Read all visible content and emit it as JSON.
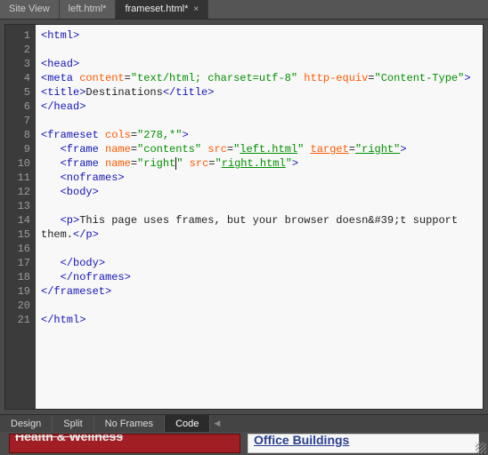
{
  "tabs": [
    {
      "label": "Site View",
      "active": false,
      "closable": false
    },
    {
      "label": "left.html*",
      "active": false,
      "closable": true
    },
    {
      "label": "frameset.html*",
      "active": true,
      "closable": true
    }
  ],
  "lines": [
    "1",
    "2",
    "3",
    "4",
    "5",
    "6",
    "7",
    "8",
    "9",
    "10",
    "11",
    "12",
    "13",
    "14",
    "",
    "15",
    "16",
    "17",
    "18",
    "19",
    "20",
    "21"
  ],
  "code": {
    "l1": {
      "open": "<html>"
    },
    "l3": {
      "open": "<head>"
    },
    "l4": {
      "tag": "<meta",
      "a1": "content",
      "v1": "\"text/html; charset=utf-8\"",
      "a2": "http-equiv",
      "v2": "\"Content-Type\"",
      "close": ">"
    },
    "l5": {
      "open": "<title>",
      "text": "Destinations",
      "close": "</title>"
    },
    "l6": {
      "open": "</head>"
    },
    "l8": {
      "tag": "<frameset",
      "a1": "cols",
      "v1": "\"278,*\"",
      "close": ">"
    },
    "l9": {
      "tag": "<frame",
      "a1": "name",
      "v1": "\"contents\"",
      "a2": "src",
      "v2": "\"",
      "link": "left.html",
      "v2end": "\"",
      "a3": "target",
      "v3": "\"right\"",
      "close": ">"
    },
    "l10": {
      "tag": "<frame",
      "a1": "name",
      "v1pre": "\"right",
      "v1post": "\"",
      "a2": "src",
      "v2": "\"",
      "link": "right.html",
      "v2end": "\"",
      "close": ">"
    },
    "l11": {
      "open": "<noframes>"
    },
    "l12": {
      "open": "<body>"
    },
    "l14": {
      "open": "<p>",
      "text": "This page uses frames, but your browser doesn&#39;t support",
      "cont": "them.",
      "close": "</p>"
    },
    "l16": {
      "open": "</body>"
    },
    "l17": {
      "open": "</noframes>"
    },
    "l18": {
      "open": "</frameset>"
    },
    "l20": {
      "open": "</html>"
    }
  },
  "bottom": {
    "design": "Design",
    "split": "Split",
    "noframes": "No Frames",
    "code": "Code"
  },
  "footer": {
    "left": "Health & Wellness",
    "right": "Office Buildings"
  }
}
